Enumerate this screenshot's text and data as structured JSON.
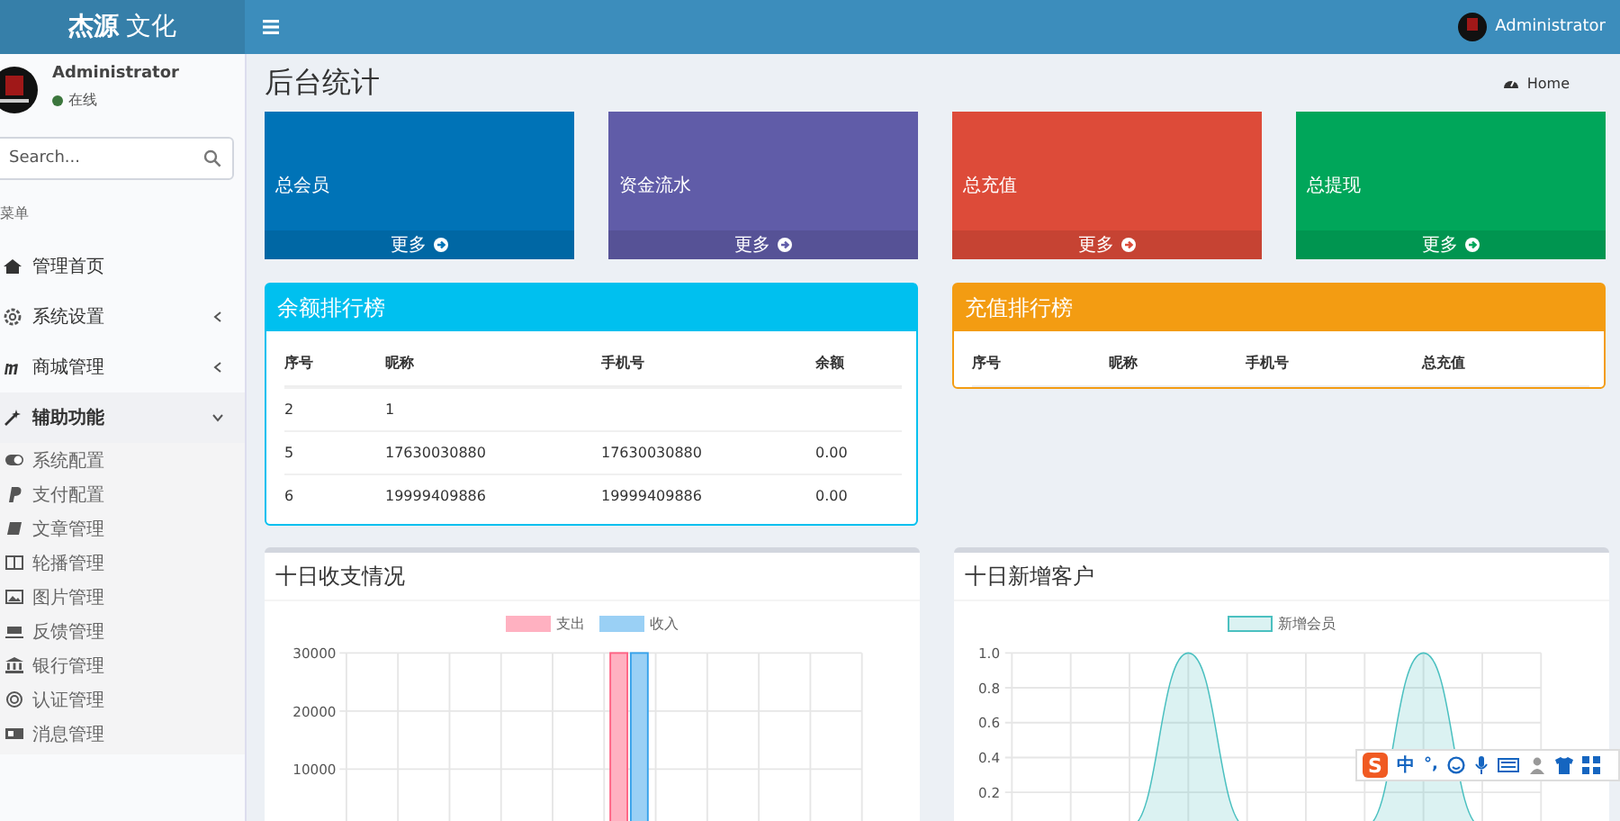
{
  "header": {
    "logo": "**杰源** 文化",
    "user": "Administrator"
  },
  "sidebar": {
    "user": {
      "name": "Administrator",
      "status": "在线",
      "online": true
    },
    "search": {
      "placeholder": "Search..."
    },
    "menu_title": "菜单",
    "items": [
      {
        "label": "管理首页",
        "kind": "link"
      },
      {
        "label": "系统设置",
        "kind": "group",
        "expanded": false
      },
      {
        "label": "商城管理",
        "kind": "group",
        "expanded": false
      },
      {
        "label": "辅助功能",
        "kind": "group",
        "expanded": true,
        "children": [
          {
            "label": "系统配置"
          },
          {
            "label": "支付配置"
          },
          {
            "label": "文章管理"
          },
          {
            "label": "轮播管理"
          },
          {
            "label": "图片管理"
          },
          {
            "label": "反馈管理"
          },
          {
            "label": "银行管理"
          },
          {
            "label": "认证管理"
          },
          {
            "label": "消息管理"
          }
        ]
      }
    ]
  },
  "page": {
    "title": "后台统计",
    "breadcrumb": "Home"
  },
  "stats": [
    {
      "label": "总会员",
      "more": "更多",
      "color": "#0073b7"
    },
    {
      "label": "资金流水",
      "more": "更多",
      "color": "#605ca8"
    },
    {
      "label": "总充值",
      "more": "更多",
      "color": "#dd4b39"
    },
    {
      "label": "总提现",
      "more": "更多",
      "color": "#00a65a"
    }
  ],
  "tables": [
    {
      "title": "余额排行榜",
      "color": "#00c0ef",
      "columns": [
        "序号",
        "昵称",
        "手机号",
        "余额"
      ],
      "rows": [
        [
          "2",
          "1"
        ],
        [
          "5",
          "17630030880",
          "17630030880",
          "0.00"
        ],
        [
          "6",
          "19999409886",
          "19999409886",
          "0.00"
        ]
      ]
    },
    {
      "title": "充值排行榜",
      "color": "#f39c12",
      "columns": [
        "序号",
        "昵称",
        "手机号",
        "总充值"
      ]
    }
  ],
  "charts": [
    {
      "title": "十日收支情况",
      "chart_data": {
        "type": "bar",
        "ylim": [
          0,
          30000
        ],
        "grid": true,
        "yticks": [
          10000,
          20000,
          30000
        ],
        "series": [
          {
            "name": "支出",
            "color": "#ffb1c1",
            "values": [
              0,
              0,
              0,
              0,
              0,
              30000,
              0,
              0,
              0,
              0
            ]
          },
          {
            "name": "收入",
            "color": "#9ad0f5",
            "values": [
              0,
              0,
              0,
              0,
              0,
              30000,
              0,
              0,
              0,
              0
            ]
          }
        ]
      }
    },
    {
      "title": "十日新增客户",
      "chart_data": {
        "type": "area",
        "ylim": [
          0,
          1
        ],
        "yticks": [
          0.2,
          0.4,
          0.6,
          0.8,
          {
            "value": 1,
            "label": "1.0"
          }
        ],
        "grid": true,
        "series": [
          {
            "name": "新增会员",
            "color": "#4bc0c0",
            "values": [
              0,
              0,
              0,
              1,
              0,
              0,
              0,
              1,
              0,
              0
            ]
          }
        ]
      }
    }
  ],
  "ime": {
    "logo": "S",
    "lang": "中",
    "punct": "°,"
  }
}
